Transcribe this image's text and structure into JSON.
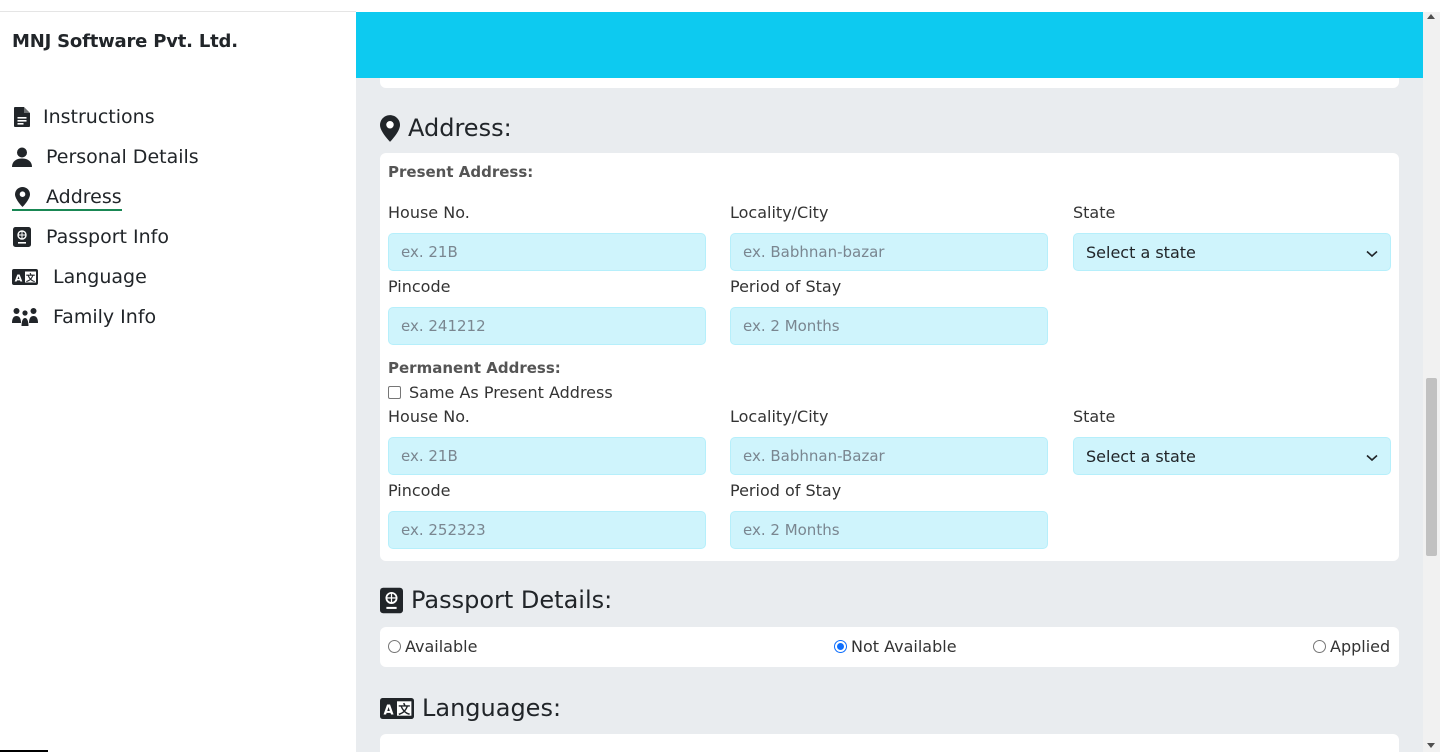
{
  "brand": "MNJ Software Pvt. Ltd.",
  "nav": [
    {
      "label": "Instructions",
      "icon": "file-icon"
    },
    {
      "label": "Personal Details",
      "icon": "user-icon"
    },
    {
      "label": "Address",
      "icon": "map-pin-icon",
      "active": true
    },
    {
      "label": "Passport Info",
      "icon": "passport-icon"
    },
    {
      "label": "Language",
      "icon": "language-icon"
    },
    {
      "label": "Family Info",
      "icon": "family-icon"
    }
  ],
  "colors": {
    "banner": "#0dcaf0",
    "input_bg": "#cff4fc",
    "active_underline": "#198754",
    "radio_accent": "#0d6efd"
  },
  "address": {
    "title": "Address:",
    "present": {
      "heading": "Present Address:",
      "house_label": "House No.",
      "house_placeholder": "ex. 21B",
      "city_label": "Locality/City",
      "city_placeholder": "ex. Babhnan-bazar",
      "state_label": "State",
      "state_value": "Select a state",
      "pin_label": "Pincode",
      "pin_placeholder": "ex. 241212",
      "period_label": "Period of Stay",
      "period_placeholder": "ex. 2 Months"
    },
    "permanent": {
      "heading": "Permanent Address:",
      "same_label": "Same As Present Address",
      "same_checked": false,
      "house_label": "House No.",
      "house_placeholder": "ex. 21B",
      "city_label": "Locality/City",
      "city_placeholder": "ex. Babhnan-Bazar",
      "state_label": "State",
      "state_value": "Select a state",
      "pin_label": "Pincode",
      "pin_placeholder": "ex. 252323",
      "period_label": "Period of Stay",
      "period_placeholder": "ex. 2 Months"
    }
  },
  "passport": {
    "title": "Passport Details:",
    "options": [
      "Available",
      "Not Available",
      "Applied"
    ],
    "selected": "Not Available"
  },
  "languages": {
    "title": "Languages:"
  }
}
